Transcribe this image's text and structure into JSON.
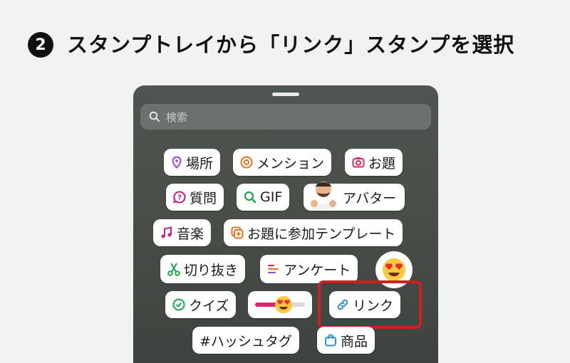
{
  "step": {
    "number": "2",
    "title": "スタンプトレイから「リンク」スタンプを選択"
  },
  "tray": {
    "search_placeholder": "検索"
  },
  "stickers": {
    "location": "場所",
    "mention": "メンション",
    "question_topic": "お題",
    "questions": "質問",
    "gif": "GIF",
    "avatar": "アバター",
    "music": "音楽",
    "add_yours_template": "お題に参加テンプレート",
    "cutout": "切り抜き",
    "poll": "アンケート",
    "quiz": "クイズ",
    "link": "リンク",
    "hashtag": "#ハッシュタグ",
    "product": "商品"
  },
  "colors": {
    "highlight": "#c8231e",
    "tray_bg": "#4a4f4a"
  }
}
